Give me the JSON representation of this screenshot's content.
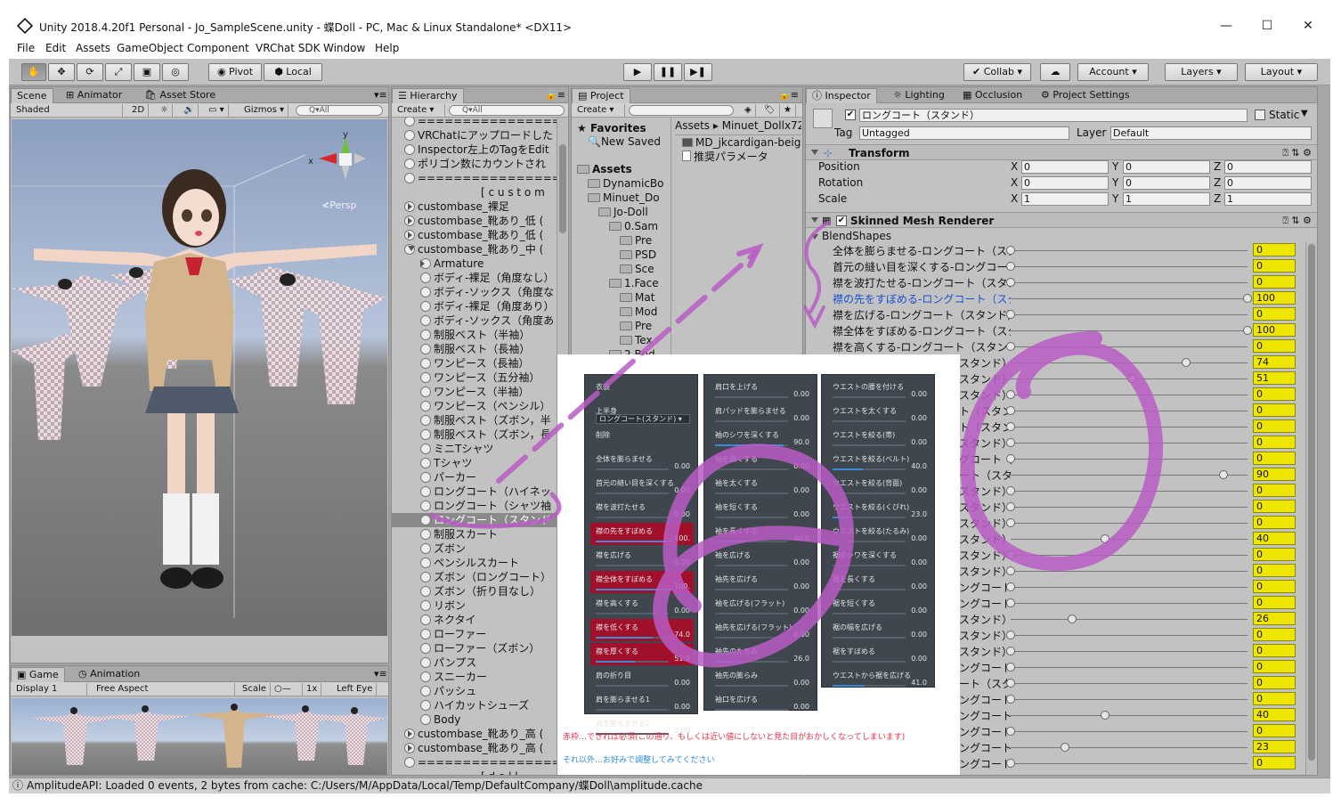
{
  "window": {
    "title": "Unity 2018.4.20f1 Personal - Jo_SampleScene.unity - 蝶Doll - PC, Mac & Linux Standalone* <DX11>",
    "minimize": "—",
    "maximize": "☐",
    "close": "✕"
  },
  "menu": [
    "File",
    "Edit",
    "Assets",
    "GameObject",
    "Component",
    "VRChat SDK",
    "Window",
    "Help"
  ],
  "toolbar": {
    "pivot": "Pivot",
    "local": "Local",
    "collab": "Collab ▾",
    "account": "Account ▾",
    "layers": "Layers ▾",
    "layout": "Layout ▾",
    "play": "▶",
    "pause": "❚❚",
    "step": "▶❚"
  },
  "scene": {
    "tabs": [
      "Scene",
      "Animator",
      "Asset Store"
    ],
    "shading": "Shaded",
    "mode2d": "2D",
    "gizmos": "Gizmos ▾",
    "search_placeholder": "Q▾All",
    "persp": "≮Persp",
    "axis_y": "y",
    "axis_x": "x"
  },
  "game": {
    "tabs": [
      "Game",
      "Animation"
    ],
    "display": "Display 1",
    "aspect": "Free Aspect",
    "scale_label": "Scale",
    "scale_value": "1x",
    "eye": "Left Eye"
  },
  "hierarchy": {
    "tab": "Hierarchy",
    "create": "Create ▾",
    "search_placeholder": "Q▾All",
    "items": [
      {
        "text": "================",
        "indent": 0,
        "fold": ""
      },
      {
        "text": "VRChatにアップロードした",
        "indent": 0,
        "fold": ""
      },
      {
        "text": "Inspector左上のTagをEdit",
        "indent": 0,
        "fold": ""
      },
      {
        "text": "ポリゴン数にカウントされ",
        "indent": 0,
        "fold": ""
      },
      {
        "text": "================",
        "indent": 0,
        "fold": ""
      },
      {
        "text": "[ c u s t o m",
        "indent": 4,
        "fold": ""
      },
      {
        "text": "custombase_裸足",
        "indent": 0,
        "fold": "r"
      },
      {
        "text": "custombase_靴あり_低 (",
        "indent": 0,
        "fold": "r"
      },
      {
        "text": "custombase_靴あり_低 (",
        "indent": 0,
        "fold": "r"
      },
      {
        "text": "custombase_靴あり_中 (",
        "indent": 0,
        "fold": "d"
      },
      {
        "text": "Armature",
        "indent": 1,
        "fold": "r"
      },
      {
        "text": "ボディ-裸足（角度なし）",
        "indent": 1,
        "fold": ""
      },
      {
        "text": "ボディ-ソックス（角度な",
        "indent": 1,
        "fold": ""
      },
      {
        "text": "ボディ-裸足（角度あり）",
        "indent": 1,
        "fold": ""
      },
      {
        "text": "ボディ-ソックス（角度あ",
        "indent": 1,
        "fold": ""
      },
      {
        "text": "制服ベスト（半袖）",
        "indent": 1,
        "fold": ""
      },
      {
        "text": "制服ベスト（長袖）",
        "indent": 1,
        "fold": ""
      },
      {
        "text": "ワンピース（長袖）",
        "indent": 1,
        "fold": ""
      },
      {
        "text": "ワンピース（五分袖）",
        "indent": 1,
        "fold": ""
      },
      {
        "text": "ワンピース（半袖）",
        "indent": 1,
        "fold": ""
      },
      {
        "text": "ワンピース（ペンシル）",
        "indent": 1,
        "fold": ""
      },
      {
        "text": "制服ベスト（ズボン，半",
        "indent": 1,
        "fold": ""
      },
      {
        "text": "制服ベスト（ズボン，長",
        "indent": 1,
        "fold": ""
      },
      {
        "text": "ミニTシャツ",
        "indent": 1,
        "fold": ""
      },
      {
        "text": "Tシャツ",
        "indent": 1,
        "fold": ""
      },
      {
        "text": "パーカー",
        "indent": 1,
        "fold": ""
      },
      {
        "text": "ロングコート（ハイネッ",
        "indent": 1,
        "fold": ""
      },
      {
        "text": "ロングコート（シャツ袖",
        "indent": 1,
        "fold": ""
      },
      {
        "text": "ロングコート（スタンド",
        "indent": 1,
        "fold": "",
        "selected": true
      },
      {
        "text": "制服スカート",
        "indent": 1,
        "fold": ""
      },
      {
        "text": "ズボン",
        "indent": 1,
        "fold": ""
      },
      {
        "text": "ペンシルスカート",
        "indent": 1,
        "fold": ""
      },
      {
        "text": "ズボン（ロングコート）",
        "indent": 1,
        "fold": ""
      },
      {
        "text": "ズボン（折り目なし）",
        "indent": 1,
        "fold": ""
      },
      {
        "text": "リボン",
        "indent": 1,
        "fold": ""
      },
      {
        "text": "ネクタイ",
        "indent": 1,
        "fold": ""
      },
      {
        "text": "ローファー",
        "indent": 1,
        "fold": ""
      },
      {
        "text": "ローファー（ズボン）",
        "indent": 1,
        "fold": ""
      },
      {
        "text": "パンプス",
        "indent": 1,
        "fold": ""
      },
      {
        "text": "スニーカー",
        "indent": 1,
        "fold": ""
      },
      {
        "text": "パッシュ",
        "indent": 1,
        "fold": ""
      },
      {
        "text": "ハイカットシューズ",
        "indent": 1,
        "fold": ""
      },
      {
        "text": "Body",
        "indent": 1,
        "fold": ""
      },
      {
        "text": "custombase_靴あり_高 (",
        "indent": 0,
        "fold": "r"
      },
      {
        "text": "custombase_靴あり_高 (",
        "indent": 0,
        "fold": "r"
      },
      {
        "text": "================",
        "indent": 0,
        "fold": ""
      },
      {
        "text": "[ d o l l",
        "indent": 4,
        "fold": ""
      }
    ]
  },
  "project": {
    "tab": "Project",
    "create": "Create ▾",
    "breadcrumb": "Assets ▸ Minuet_Dollx72",
    "tree": [
      {
        "text": "Favorites",
        "depth": 0,
        "kind": "star",
        "bold": true
      },
      {
        "text": "New Saved",
        "depth": 1,
        "kind": "search"
      },
      {
        "text": "Assets",
        "depth": 0,
        "kind": "folder",
        "bold": true
      },
      {
        "text": "DynamicBo",
        "depth": 1,
        "kind": "folder"
      },
      {
        "text": "Minuet_Do",
        "depth": 1,
        "kind": "folder"
      },
      {
        "text": "Jo-Doll",
        "depth": 2,
        "kind": "folder"
      },
      {
        "text": "0.Sam",
        "depth": 3,
        "kind": "folder"
      },
      {
        "text": "Pre",
        "depth": 4,
        "kind": "folder"
      },
      {
        "text": "PSD",
        "depth": 4,
        "kind": "folder"
      },
      {
        "text": "Sce",
        "depth": 4,
        "kind": "folder"
      },
      {
        "text": "1.Face",
        "depth": 3,
        "kind": "folder"
      },
      {
        "text": "Mat",
        "depth": 4,
        "kind": "folder"
      },
      {
        "text": "Mod",
        "depth": 4,
        "kind": "folder"
      },
      {
        "text": "Pre",
        "depth": 4,
        "kind": "folder"
      },
      {
        "text": "Tex",
        "depth": 4,
        "kind": "folder"
      },
      {
        "text": "2.Bod",
        "depth": 3,
        "kind": "folder"
      }
    ],
    "files": [
      "MD_jkcardigan-beig",
      "推奨パラメータ"
    ]
  },
  "inspector": {
    "tabs": [
      "Inspector",
      "Lighting",
      "Occlusion",
      "Project Settings"
    ],
    "object_name": "ロングコート（スタンド）",
    "static": "Static",
    "tag_label": "Tag",
    "tag": "Untagged",
    "layer_label": "Layer",
    "layer": "Default",
    "transform": {
      "title": "Transform",
      "rows": [
        {
          "label": "Position",
          "x": "0",
          "y": "0",
          "z": "0"
        },
        {
          "label": "Rotation",
          "x": "0",
          "y": "0",
          "z": "0"
        },
        {
          "label": "Scale",
          "x": "1",
          "y": "1",
          "z": "1"
        }
      ]
    },
    "smr": {
      "title": "Skinned Mesh Renderer",
      "blend_title": "BlendShapes",
      "shapes": [
        {
          "label": "全体を膨らませる-ロングコート（スタン",
          "value": "0",
          "pos": 0
        },
        {
          "label": "首元の縫い目を深くする-ロングコート",
          "value": "0",
          "pos": 0
        },
        {
          "label": "襟を波打たせる-ロングコート（スタンド",
          "value": "0",
          "pos": 0
        },
        {
          "label": "襟の先をすぼめる-ロングコート（スタン",
          "value": "100",
          "pos": 1,
          "hl": true
        },
        {
          "label": "襟を広げる-ロングコート（スタンド）",
          "value": "0",
          "pos": 0
        },
        {
          "label": "襟全体をすぼめる-ロングコート（スタン",
          "value": "100",
          "pos": 1
        },
        {
          "label": "襟を高くする-ロングコート（スタンド）",
          "value": "0",
          "pos": 0
        },
        {
          "label": "スタンド）",
          "value": "74",
          "pos": 0.74
        },
        {
          "label": "スタンド）",
          "value": "51",
          "pos": 0.51
        },
        {
          "label": "スタンド）",
          "value": "0",
          "pos": 0
        },
        {
          "label": "ト（スタン",
          "value": "0",
          "pos": 0
        },
        {
          "label": "ト（スタン",
          "value": "0",
          "pos": 0
        },
        {
          "label": "スタンド）",
          "value": "0",
          "pos": 0
        },
        {
          "label": "グコート（",
          "value": "0",
          "pos": 0
        },
        {
          "label": "ート（スタ",
          "value": "90",
          "pos": 0.9
        },
        {
          "label": "スタンド）",
          "value": "0",
          "pos": 0
        },
        {
          "label": "スタンド）",
          "value": "0",
          "pos": 0
        },
        {
          "label": "スタンド）",
          "value": "0",
          "pos": 0
        },
        {
          "label": "スタンド）",
          "value": "40",
          "pos": 0.4
        },
        {
          "label": "スタンド）",
          "value": "0",
          "pos": 0
        },
        {
          "label": "スタンド）",
          "value": "0",
          "pos": 0
        },
        {
          "label": "ングコート（",
          "value": "0",
          "pos": 0
        },
        {
          "label": "ングコート（",
          "value": "0",
          "pos": 0
        },
        {
          "label": "スタンド）",
          "value": "26",
          "pos": 0.26
        },
        {
          "label": "スタンド）",
          "value": "0",
          "pos": 0
        },
        {
          "label": "スタンド）",
          "value": "0",
          "pos": 0
        },
        {
          "label": "ングコート（ス",
          "value": "0",
          "pos": 0
        },
        {
          "label": "ート（スタ",
          "value": "0",
          "pos": 0
        },
        {
          "label": "ングコート（ス",
          "value": "0",
          "pos": 0
        },
        {
          "label": "ングコート",
          "value": "40",
          "pos": 0.4
        },
        {
          "label": "ングコート",
          "value": "0",
          "pos": 0
        },
        {
          "label": "ングコート",
          "value": "23",
          "pos": 0.23
        },
        {
          "label": "ングコート",
          "value": "0",
          "pos": 0
        }
      ]
    }
  },
  "overlay": {
    "col1": [
      {
        "t": "衣装",
        "v": "",
        "f": 0
      },
      {
        "t": "上半身",
        "v": "",
        "f": 0,
        "dropdown": "ロングコート(スタンド)"
      },
      {
        "t": "削除",
        "v": "",
        "f": 0
      },
      {
        "t": "全体を膨らませる",
        "v": "0.00",
        "f": 0
      },
      {
        "t": "首元の縫い目を深くする",
        "v": "0.00",
        "f": 0
      },
      {
        "t": "襟を波打たせる",
        "v": "0.00",
        "f": 0
      },
      {
        "t": "襟の先をすぼめる",
        "v": "100.",
        "f": 1,
        "red": true
      },
      {
        "t": "襟を広げる",
        "v": "0.00",
        "f": 0
      },
      {
        "t": "襟全体をすぼめる",
        "v": "100.",
        "f": 1,
        "red": true
      },
      {
        "t": "襟を高くする",
        "v": "0.00",
        "f": 0
      },
      {
        "t": "襟を低くする",
        "v": "74.0",
        "f": 0.74,
        "red": true
      },
      {
        "t": "襟を厚くする",
        "v": "51.0",
        "f": 0.51,
        "red": true
      },
      {
        "t": "肩の折り目",
        "v": "0.00",
        "f": 0
      },
      {
        "t": "肩を膨らませる1",
        "v": "0.00",
        "f": 0
      },
      {
        "t": "肩を膨らませる2",
        "v": "0.00",
        "f": 0
      }
    ],
    "col2": [
      {
        "t": "肩口を上げる",
        "v": "0.00",
        "f": 0
      },
      {
        "t": "肩パッドを膨らませる",
        "v": "0.00",
        "f": 0
      },
      {
        "t": "袖のシワを深くする",
        "v": "90.0",
        "f": 0.9
      },
      {
        "t": "袖を細くする",
        "v": "0.00",
        "f": 0
      },
      {
        "t": "袖を太くする",
        "v": "0.00",
        "f": 0
      },
      {
        "t": "袖を短くする",
        "v": "0.00",
        "f": 0
      },
      {
        "t": "袖を長くする",
        "v": "40.0",
        "f": 0.4
      },
      {
        "t": "袖を広げる",
        "v": "0.00",
        "f": 0
      },
      {
        "t": "袖先を広げる",
        "v": "0.00",
        "f": 0
      },
      {
        "t": "袖を広げる(フラット)",
        "v": "0.00",
        "f": 0
      },
      {
        "t": "袖先を広げる(フラット)",
        "v": "0.00",
        "f": 0
      },
      {
        "t": "袖先のたるみ",
        "v": "26.0",
        "f": 0.26
      },
      {
        "t": "袖先の膨らみ",
        "v": "0.00",
        "f": 0
      },
      {
        "t": "袖口を広げる",
        "v": "0.00",
        "f": 0
      }
    ],
    "col3": [
      {
        "t": "ウエストの腰を付ける",
        "v": "0.00",
        "f": 0
      },
      {
        "t": "ウエストを太くする",
        "v": "0.00",
        "f": 0
      },
      {
        "t": "ウエストを絞る(帯)",
        "v": "0.00",
        "f": 0
      },
      {
        "t": "ウエストを絞る(ベルト)",
        "v": "40.0",
        "f": 0.4
      },
      {
        "t": "ウエストを絞る(背面)",
        "v": "0.00",
        "f": 0
      },
      {
        "t": "ウエストを絞る(くびれ)",
        "v": "23.0",
        "f": 0.23
      },
      {
        "t": "ウエストを絞る(たるみ)",
        "v": "0.00",
        "f": 0
      },
      {
        "t": "裾のシワを深くする",
        "v": "0.00",
        "f": 0
      },
      {
        "t": "裾を長くする",
        "v": "0.00",
        "f": 0
      },
      {
        "t": "裾を短くする",
        "v": "0.00",
        "f": 0
      },
      {
        "t": "裾の幅を広げる",
        "v": "0.00",
        "f": 0
      },
      {
        "t": "裾をすぼめる",
        "v": "0.00",
        "f": 0
      },
      {
        "t": "ウエストから裾を広げる",
        "v": "41.0",
        "f": 0.41
      }
    ],
    "note_red": "赤枠…できれば必須(この通り、もしくは近い値にしないと見た目がおかしくなってしまいます)",
    "note_blue": "それ以外…お好みで調整してみてください"
  },
  "status": "AmplitudeAPI: Loaded 0 events, 2 bytes from cache: C:/Users/M/AppData/Local/Temp/DefaultCompany/蝶Doll\\amplitude.cache",
  "colors": {
    "accent": "#efe600",
    "selected": "#8a8a8a",
    "annot": "#b85cc4"
  }
}
